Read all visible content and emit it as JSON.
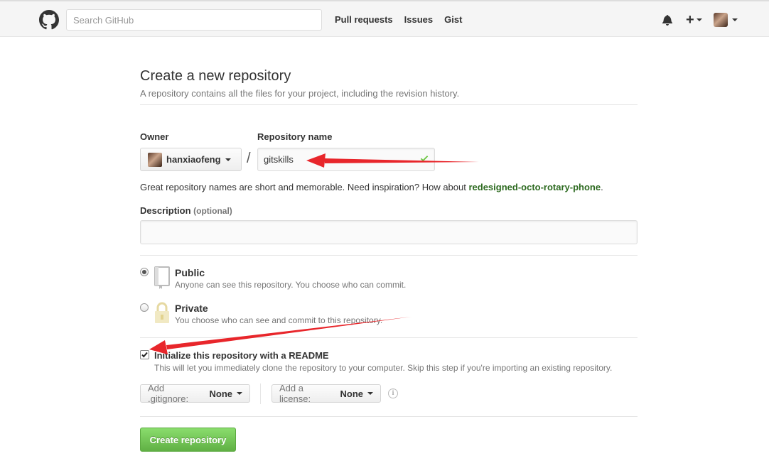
{
  "header": {
    "search_placeholder": "Search GitHub",
    "nav": [
      "Pull requests",
      "Issues",
      "Gist"
    ]
  },
  "page": {
    "title": "Create a new repository",
    "subtitle": "A repository contains all the files for your project, including the revision history."
  },
  "form": {
    "owner_label": "Owner",
    "owner_value": "hanxiaofeng",
    "slash": "/",
    "repo_label": "Repository name",
    "repo_value": "gitskills",
    "hint_text": "Great repository names are short and memorable. Need inspiration? How about ",
    "hint_suggestion": "redesigned-octo-rotary-phone",
    "hint_end": ".",
    "description_label": "Description",
    "description_optional": "(optional)",
    "description_value": ""
  },
  "visibility": {
    "public_title": "Public",
    "public_note": "Anyone can see this repository. You choose who can commit.",
    "private_title": "Private",
    "private_note": "You choose who can see and commit to this repository.",
    "selected": "Public"
  },
  "init": {
    "checked": true,
    "title": "Initialize this repository with a README",
    "note": "This will let you immediately clone the repository to your computer. Skip this step if you're importing an existing repository."
  },
  "dropdowns": {
    "gitignore_label": "Add .gitignore:",
    "gitignore_value": "None",
    "license_label": "Add a license:",
    "license_value": "None"
  },
  "submit_label": "Create repository",
  "colors": {
    "accent_green": "#60b044",
    "suggestion_green": "#2d6a20",
    "annotation_red": "#e8262b"
  },
  "icons": [
    "github-logo-icon",
    "bell-icon",
    "plus-icon",
    "check-icon",
    "book-icon",
    "lock-icon",
    "info-icon"
  ]
}
